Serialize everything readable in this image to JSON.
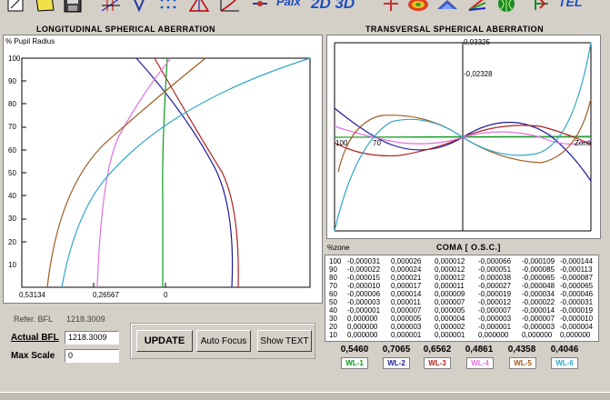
{
  "toolbar": {
    "items": [
      "new-plot-icon",
      "note-icon",
      "save-icon",
      "lens-layout-icon",
      "ray-fan-icon",
      "spot-diagram-icon",
      "aberration-triangle-icon",
      "distortion-icon",
      "paraxial-icon",
      "layout-2d-3d-icon",
      "target-icon",
      "color-map-icon",
      "surface-3d-icon",
      "spectrum-icon",
      "globe-icon",
      "tolerance-icon"
    ],
    "paix_label": "Paix",
    "two_d_three_d_label": "2D 3D",
    "tel_label": "TEL"
  },
  "longitudinal": {
    "title": "LONGITUDINAL SPHERICAL  ABERRATION",
    "y_axis_label": "% Pupil Radius",
    "y_ticks": [
      "100",
      "90",
      "80",
      "70",
      "60",
      "50",
      "40",
      "30",
      "20",
      "10"
    ],
    "x_ticks": [
      "0,53134",
      "0,26567",
      "0"
    ]
  },
  "transversal": {
    "title": "TRANSVERSAL SPHERICAL  ABERRATION",
    "top_label": "0,03325",
    "second_label": "-0,02328",
    "left_label": "100",
    "mid_label": "70",
    "right_label": "Zone"
  },
  "coma": {
    "zone_label": "%zone",
    "title": "COMA [ O.S.C.]",
    "rows": [
      {
        "zone": "100",
        "values": [
          "-0,000031",
          "0,000026",
          "0,000012",
          "-0,000066",
          "-0,000109",
          "-0,000144"
        ]
      },
      {
        "zone": "90",
        "values": [
          "-0,000022",
          "0,000024",
          "0,000012",
          "-0,000051",
          "-0,000085",
          "-0,000113"
        ]
      },
      {
        "zone": "80",
        "values": [
          "-0,000015",
          "0,000021",
          "0,000012",
          "-0,000038",
          "-0,000065",
          "-0,000087"
        ]
      },
      {
        "zone": "70",
        "values": [
          "-0,000010",
          "0,000017",
          "0,000011",
          "-0,000027",
          "-0,000048",
          "-0,000065"
        ]
      },
      {
        "zone": "60",
        "values": [
          "-0,000006",
          "0,000014",
          "0,000009",
          "-0,000019",
          "-0,000034",
          "-0,000046"
        ]
      },
      {
        "zone": "50",
        "values": [
          "-0,000003",
          "0,000011",
          "0,000007",
          "-0,000012",
          "-0,000022",
          "-0,000031"
        ]
      },
      {
        "zone": "40",
        "values": [
          "-0,000001",
          "0,000007",
          "0,000005",
          "-0,000007",
          "-0,000014",
          "-0,000019"
        ]
      },
      {
        "zone": "30",
        "values": [
          "0,000000",
          "0,000005",
          "0,000004",
          "-0,000003",
          "-0,000007",
          "-0,000010"
        ]
      },
      {
        "zone": "20",
        "values": [
          "0,000000",
          "0,000003",
          "0,000002",
          "-0,000001",
          "-0,000003",
          "-0,000004"
        ]
      },
      {
        "zone": "10",
        "values": [
          "0,000000",
          "0,000001",
          "0,000001",
          "0,000000",
          "0,000000",
          "0,000000"
        ]
      }
    ],
    "summary": [
      "0,5460",
      "0,7065",
      "0,6562",
      "0,4861",
      "0,4358",
      "0,4046"
    ],
    "wl_labels": [
      "WL-1",
      "WL-2",
      "WL-3",
      "WL-4",
      "WL-5",
      "WL-6"
    ],
    "wl_colors": [
      "#0a9a1a",
      "#1a1a9a",
      "#b02020",
      "#e070e0",
      "#a05a20",
      "#30a8c8"
    ]
  },
  "controls": {
    "refer_bfl_label": "Refer.  BFL",
    "refer_bfl_value": "1218.3009",
    "actual_bfl_label": "Actual BFL",
    "actual_bfl_value": "1218.3009",
    "max_scale_label": "Max Scale",
    "max_scale_value": "0",
    "update_label": "UPDATE",
    "auto_focus_label": "Auto Focus",
    "show_text_label": "Show TEXT"
  }
}
